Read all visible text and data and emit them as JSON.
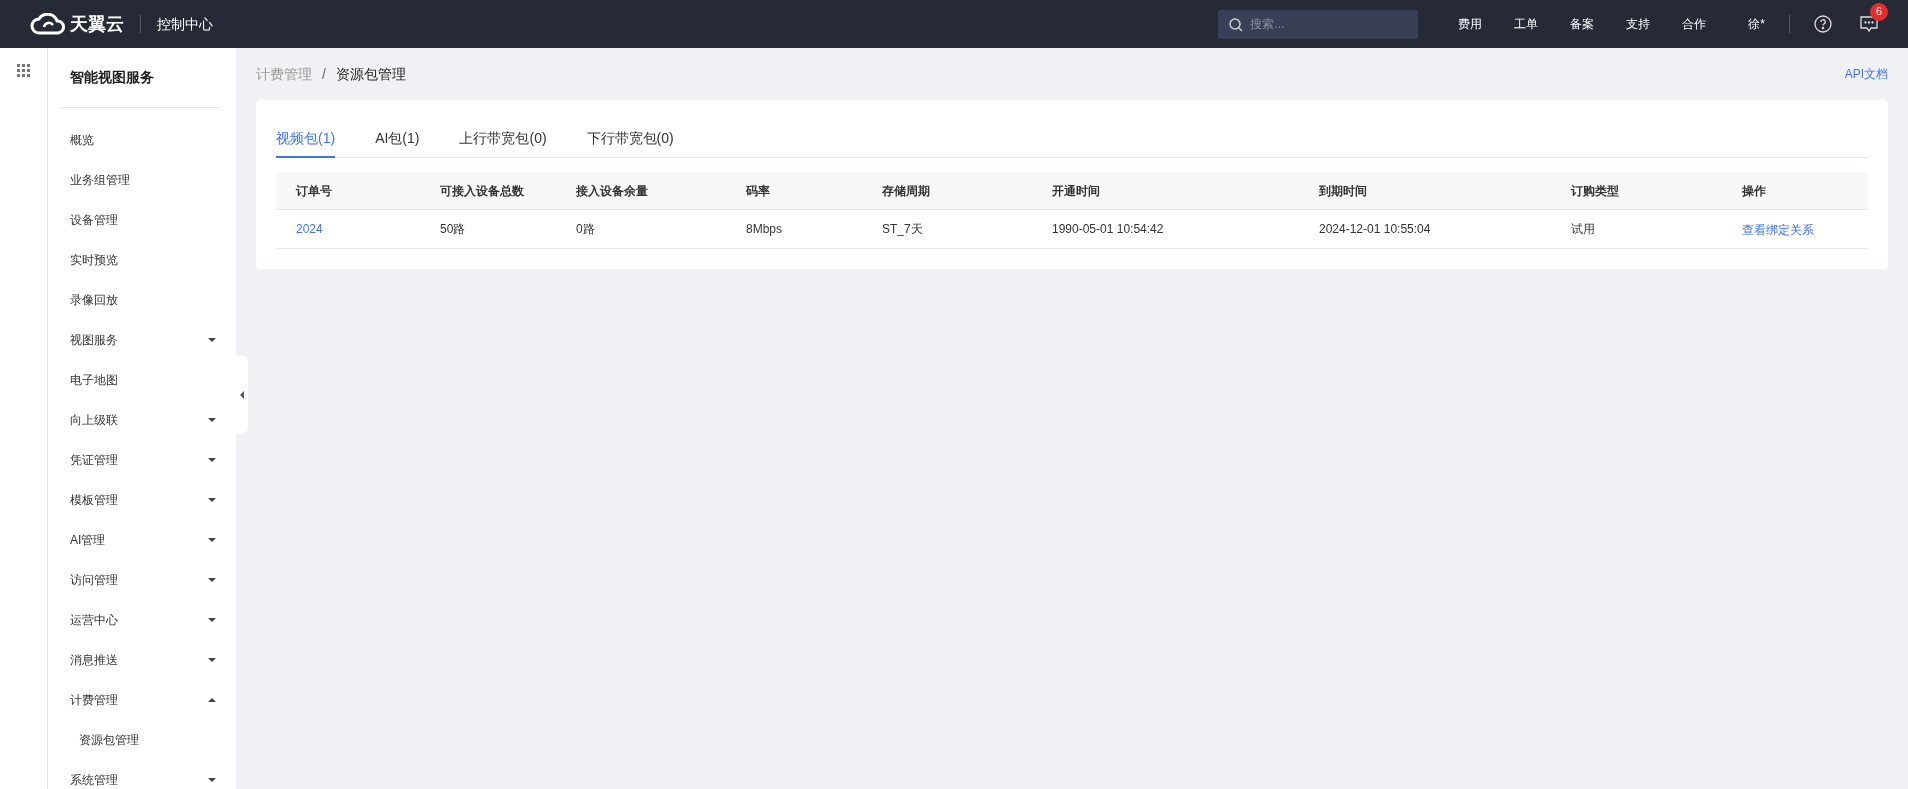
{
  "header": {
    "brand": "天翼云",
    "console": "控制中心",
    "search": {
      "placeholder": "搜索..."
    },
    "nav": [
      "费用",
      "工单",
      "备案",
      "支持",
      "合作"
    ],
    "user": "徐*",
    "notifications": "6"
  },
  "sidebar": {
    "title": "智能视图服务",
    "items": [
      {
        "label": "概览"
      },
      {
        "label": "业务组管理"
      },
      {
        "label": "设备管理"
      },
      {
        "label": "实时预览"
      },
      {
        "label": "录像回放"
      },
      {
        "label": "视图服务",
        "expanded": false
      },
      {
        "label": "电子地图"
      },
      {
        "label": "向上级联",
        "expanded": false
      },
      {
        "label": "凭证管理",
        "expanded": false
      },
      {
        "label": "模板管理",
        "expanded": false
      },
      {
        "label": "AI管理",
        "expanded": false
      },
      {
        "label": "访问管理",
        "expanded": false
      },
      {
        "label": "运营中心",
        "expanded": false
      },
      {
        "label": "消息推送",
        "expanded": false
      },
      {
        "label": "计费管理",
        "expanded": true,
        "children": [
          {
            "label": "资源包管理"
          }
        ]
      },
      {
        "label": "系统管理",
        "expanded": false
      }
    ]
  },
  "breadcrumb": [
    "计费管理",
    "资源包管理"
  ],
  "breadcrumb_separator": "/",
  "api_link": "API文档",
  "tabs": [
    {
      "label": "视频包(1)",
      "selected": true
    },
    {
      "label": "AI包(1)",
      "selected": false
    },
    {
      "label": "上行带宽包(0)",
      "selected": false
    },
    {
      "label": "下行带宽包(0)",
      "selected": false
    }
  ],
  "table": {
    "columns": [
      "订单号",
      "可接入设备总数",
      "接入设备余量",
      "码率",
      "存储周期",
      "开通时间",
      "到期时间",
      "订购类型",
      "操作"
    ],
    "rows": [
      {
        "cells": [
          "2024",
          "50路",
          "0路",
          "8Mbps",
          "ST_7天",
          "1990-05-01 10:54:42",
          "2024-12-01 10:55:04",
          "试用"
        ],
        "action": "查看绑定关系"
      }
    ]
  }
}
